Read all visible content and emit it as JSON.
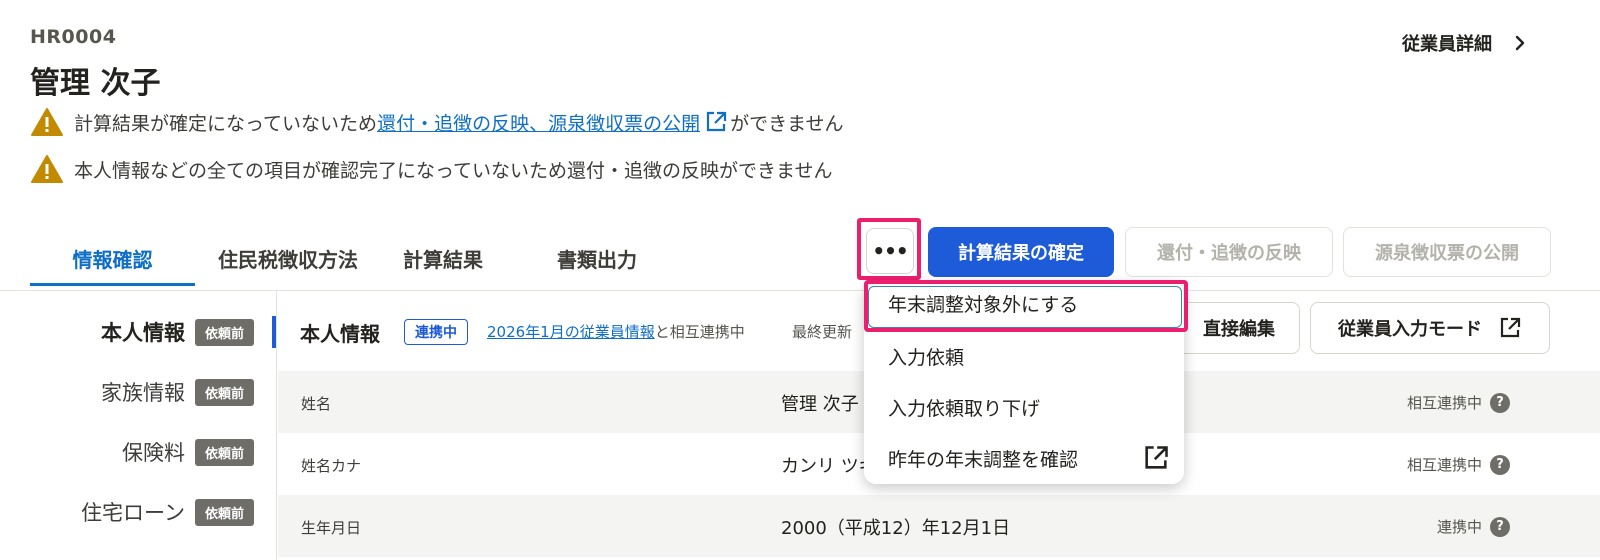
{
  "header": {
    "employee_code": "HR0004",
    "employee_name": "管理 次子",
    "detail_link": "従業員詳細"
  },
  "warnings": {
    "w1_prefix": "計算結果が確定になっていないため",
    "w1_link": "還付・追徴の反映、源泉徴収票の公開",
    "w1_suffix": "ができません",
    "w2": "本人情報などの全ての項目が確認完了になっていないため還付・追徴の反映ができません"
  },
  "tabs": [
    {
      "label": "情報確認"
    },
    {
      "label": "住民税徴収方法"
    },
    {
      "label": "計算結果"
    },
    {
      "label": "書類出力"
    }
  ],
  "toolbar": {
    "more_label": "•••",
    "confirm_label": "計算結果の確定",
    "reflect_label": "還付・追徴の反映",
    "publish_label": "源泉徴収票の公開"
  },
  "sidebar": {
    "items": [
      {
        "label": "本人情報",
        "badge": "依頼前"
      },
      {
        "label": "家族情報",
        "badge": "依頼前"
      },
      {
        "label": "保険料",
        "badge": "依頼前"
      },
      {
        "label": "住宅ローン",
        "badge": "依頼前"
      }
    ]
  },
  "section": {
    "title": "本人情報",
    "status_badge": "連携中",
    "sync_link": "2026年1月の従業員情報",
    "sync_suffix": "と相互連携中",
    "last_updated": "最終更新",
    "edit_button": "直接編集",
    "input_mode_button": "従業員入力モード"
  },
  "table": {
    "rows": [
      {
        "key": "姓名",
        "value": "管理 次子",
        "status": "相互連携中"
      },
      {
        "key": "姓名カナ",
        "value": "カンリ ツギコ",
        "status": "相互連携中"
      },
      {
        "key": "生年月日",
        "value": "2000（平成12）年12月1日",
        "status": "連携中"
      }
    ],
    "help_glyph": "?"
  },
  "menu": {
    "items": [
      {
        "label": "年末調整対象外にする"
      },
      {
        "label": "入力依頼"
      },
      {
        "label": "入力依頼取り下げ"
      },
      {
        "label": "昨年の年末調整を確認"
      }
    ]
  },
  "colors": {
    "primary": "#1d5bd8",
    "link": "#0f6fc6",
    "warning": "#c28a00",
    "highlight": "#ec1e6e",
    "badge": "#6e6d68"
  }
}
